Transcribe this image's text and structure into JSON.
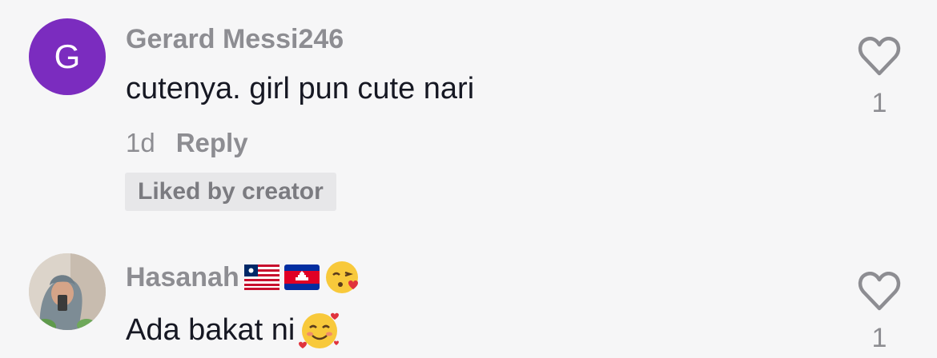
{
  "comments": [
    {
      "avatar_letter": "G",
      "avatar_color": "#7b2cbf",
      "username": "Gerard Messi246",
      "text": "cutenya. girl pun cute nari",
      "time": "1d",
      "reply_label": "Reply",
      "badge": "Liked by creator",
      "like_count": "1"
    },
    {
      "username": "Hasanah",
      "username_emojis": [
        "liberia-flag",
        "cambodia-flag",
        "kissing-heart-emoji"
      ],
      "text": "Ada bakat ni",
      "text_emoji": "smiling-hearts-emoji",
      "like_count": "1"
    }
  ],
  "colors": {
    "background": "#f6f6f7",
    "secondary_text": "#8d8d92",
    "primary_text": "#161823",
    "badge_bg": "#e7e7e9"
  }
}
